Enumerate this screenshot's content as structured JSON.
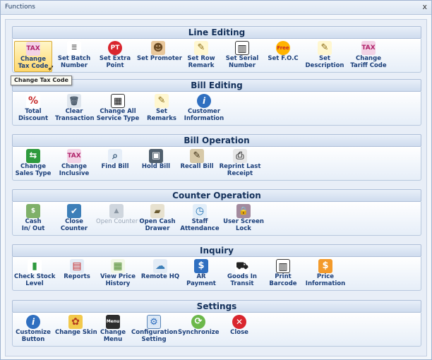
{
  "window": {
    "title": "Functions",
    "close": "x"
  },
  "groups": [
    {
      "title": "Line Editing",
      "buttons": [
        {
          "l1": "Change",
          "l2": "Tax Code",
          "icon": "TAX",
          "bg": "#f3d3e6",
          "fg": "#b0236a"
        },
        {
          "l1": "Set Batch",
          "l2": "Number",
          "icon": "☰",
          "bg": "#ffffff",
          "fg": "#111111"
        },
        {
          "l1": "Set Extra",
          "l2": "Point",
          "icon": "PT",
          "bg": "#d9262e",
          "fg": "#ffffff"
        },
        {
          "l1": "Set Promoter",
          "l2": "",
          "icon": "☻",
          "bg": "#e9c79b",
          "fg": "#6b4a23"
        },
        {
          "l1": "Set Row",
          "l2": "Remark",
          "icon": "✎",
          "bg": "#fff7d0",
          "fg": "#8a6a10"
        },
        {
          "l1": "Set Serial",
          "l2": "Number",
          "icon": "▥",
          "bg": "#ffffff",
          "fg": "#111111"
        },
        {
          "l1": "Set F.O.C",
          "l2": "",
          "icon": "Free",
          "bg": "#ffb300",
          "fg": "#c62828"
        },
        {
          "l1": "Set",
          "l2": "Description",
          "icon": "✎",
          "bg": "#fff7d0",
          "fg": "#8a6a10"
        },
        {
          "l1": "Change",
          "l2": "Tariff Code",
          "icon": "TAX",
          "bg": "#f3d3e6",
          "fg": "#b0236a"
        }
      ]
    },
    {
      "title": "Bill Editing",
      "buttons": [
        {
          "l1": "Total",
          "l2": "Discount",
          "icon": "%",
          "bg": "#ffffff",
          "fg": "#c62828"
        },
        {
          "l1": "Clear",
          "l2": "Transaction",
          "icon": "🗑",
          "bg": "#dfe6ee",
          "fg": "#4a5a6a"
        },
        {
          "l1": "Change All",
          "l2": "Service Type",
          "icon": "▦",
          "bg": "#ffffff",
          "fg": "#111111"
        },
        {
          "l1": "Set",
          "l2": "Remarks",
          "icon": "✎",
          "bg": "#fff7d0",
          "fg": "#8a6a10"
        },
        {
          "l1": "Customer",
          "l2": "Information",
          "icon": "i",
          "bg": "#2f6fc0",
          "fg": "#ffffff"
        }
      ]
    },
    {
      "title": "Bill Operation",
      "buttons": [
        {
          "l1": "Change",
          "l2": "Sales Type",
          "icon": "⇆",
          "bg": "#2e9a3e",
          "fg": "#ffffff"
        },
        {
          "l1": "Change",
          "l2": "Inclusive",
          "icon": "TAX",
          "bg": "#f3d3e6",
          "fg": "#b0236a"
        },
        {
          "l1": "Find Bill",
          "l2": "",
          "icon": "⌕",
          "bg": "#e6eef8",
          "fg": "#335577"
        },
        {
          "l1": "Hold Bill",
          "l2": "",
          "icon": "▣",
          "bg": "#51606e",
          "fg": "#ffffff"
        },
        {
          "l1": "Recall Bill",
          "l2": "",
          "icon": "✎",
          "bg": "#d7c9a8",
          "fg": "#3a2c12"
        },
        {
          "l1": "Reprint Last",
          "l2": "Receipt",
          "icon": "⎙",
          "bg": "#e8e8e8",
          "fg": "#555555"
        }
      ]
    },
    {
      "title": "Counter Operation",
      "buttons": [
        {
          "l1": "Cash",
          "l2": "In/ Out",
          "icon": "$",
          "bg": "#7fb069",
          "fg": "#ffffff"
        },
        {
          "l1": "Close",
          "l2": "Counter",
          "icon": "✔",
          "bg": "#3d7fb8",
          "fg": "#ffffff"
        },
        {
          "l1": "Open Counter",
          "l2": "",
          "icon": "▲",
          "bg": "#cfd6de",
          "fg": "#8a96a3",
          "disabled": true
        },
        {
          "l1": "Open Cash",
          "l2": "Drawer",
          "icon": "▰",
          "bg": "#e7e1cf",
          "fg": "#6a5a30"
        },
        {
          "l1": "Staff",
          "l2": "Attendance",
          "icon": "◷",
          "bg": "#e2eef9",
          "fg": "#1e6fb0"
        },
        {
          "l1": "User Screen",
          "l2": "Lock",
          "icon": "🔒",
          "bg": "#a38a9e",
          "fg": "#ffffff"
        }
      ]
    },
    {
      "title": "Inquiry",
      "buttons": [
        {
          "l1": "Check Stock",
          "l2": "Level",
          "icon": "▮",
          "bg": "#ffffff",
          "fg": "#2e9a3e"
        },
        {
          "l1": "Reports",
          "l2": "",
          "icon": "▤",
          "bg": "#e3ecf6",
          "fg": "#c62828"
        },
        {
          "l1": "View Price",
          "l2": "History",
          "icon": "▦",
          "bg": "#f1f7e6",
          "fg": "#4e8a2e"
        },
        {
          "l1": "Remote HQ",
          "l2": "",
          "icon": "☁",
          "bg": "#e3ecf6",
          "fg": "#3d7fb8"
        },
        {
          "l1": "AR",
          "l2": "Payment",
          "icon": "$",
          "bg": "#2f6fc0",
          "fg": "#ffffff"
        },
        {
          "l1": "Goods In",
          "l2": "Transit",
          "icon": "⛟",
          "bg": "#ffffff",
          "fg": "#222222"
        },
        {
          "l1": "Print",
          "l2": "Barcode",
          "icon": "▥",
          "bg": "#ffffff",
          "fg": "#111111"
        },
        {
          "l1": "Price",
          "l2": "Information",
          "icon": "$",
          "bg": "#f39a2b",
          "fg": "#ffffff"
        }
      ]
    },
    {
      "title": "Settings",
      "buttons": [
        {
          "l1": "Customize",
          "l2": "Button",
          "icon": "i",
          "bg": "#2f6fc0",
          "fg": "#ffffff"
        },
        {
          "l1": "Change Skin",
          "l2": "",
          "icon": "✿",
          "bg": "#f2c94c",
          "fg": "#b33a1f"
        },
        {
          "l1": "Change",
          "l2": "Menu",
          "icon": "Menu",
          "bg": "#2d2d2d",
          "fg": "#ffffff"
        },
        {
          "l1": "Configuration",
          "l2": "Setting",
          "icon": "⚙",
          "bg": "#dbe8f6",
          "fg": "#2f6fc0"
        },
        {
          "l1": "Synchronize",
          "l2": "",
          "icon": "⟳",
          "bg": "#6cb84b",
          "fg": "#ffffff"
        },
        {
          "l1": "Close",
          "l2": "",
          "icon": "✕",
          "bg": "#d9262e",
          "fg": "#ffffff"
        }
      ]
    }
  ],
  "tooltip": "Change Tax Code"
}
